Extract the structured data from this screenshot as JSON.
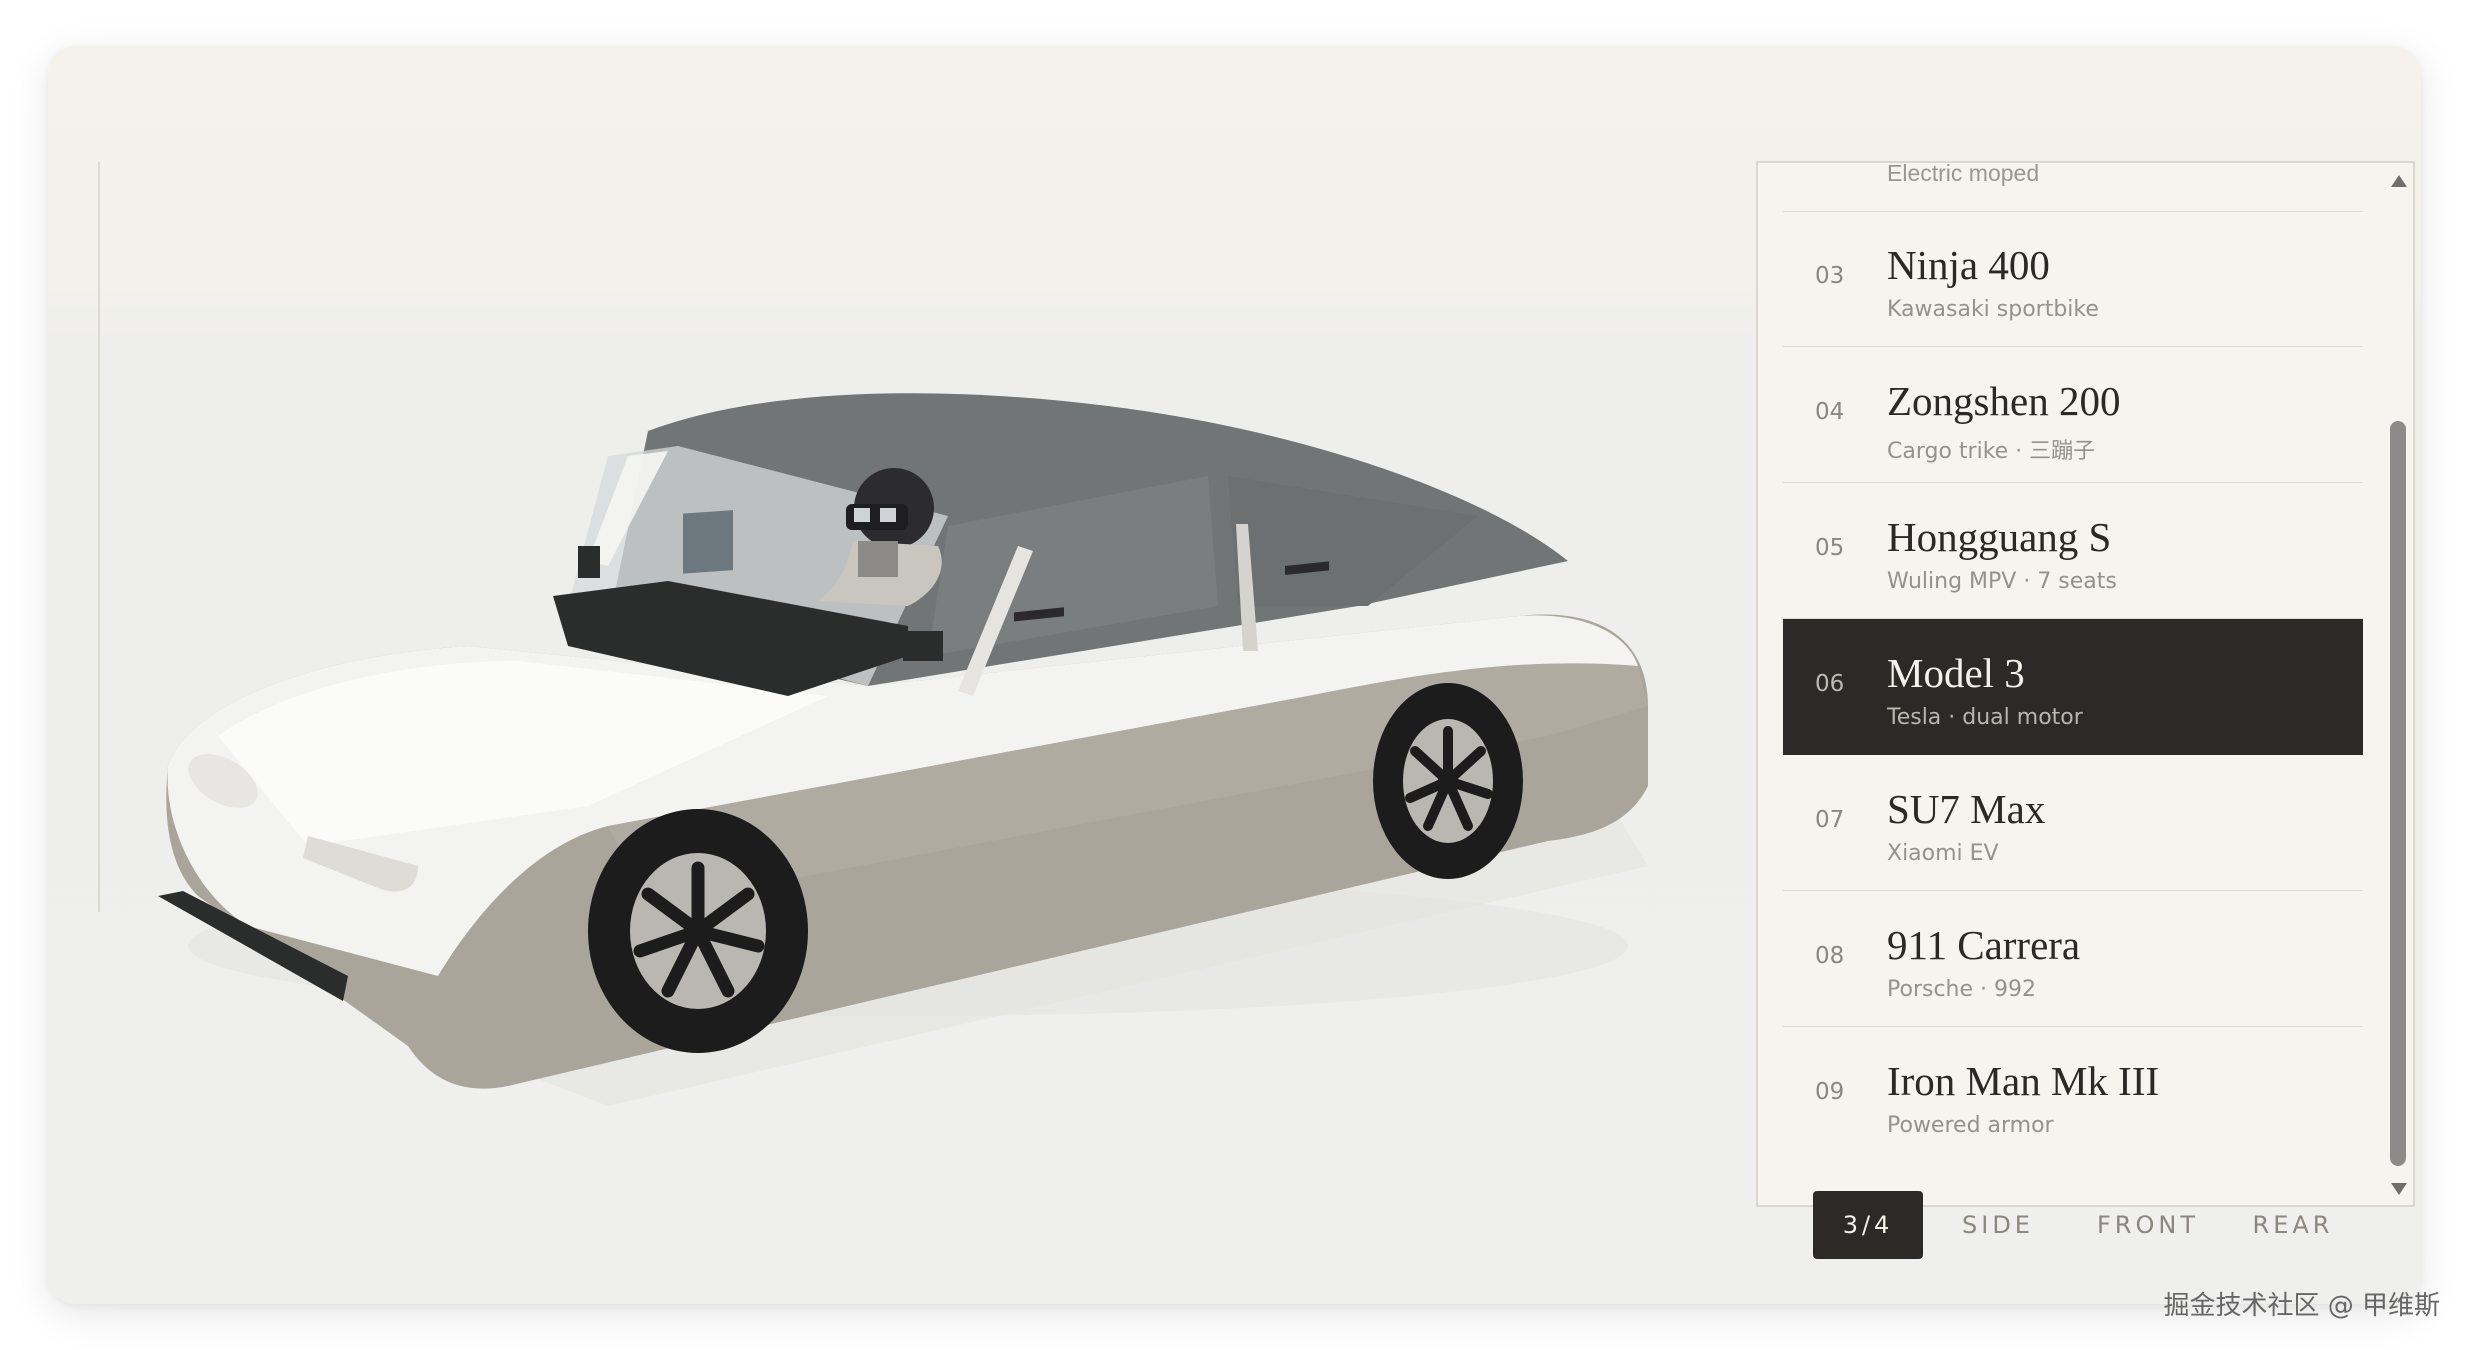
{
  "list": {
    "partial_item_subtitle": "Electric moped",
    "items": [
      {
        "num": "03",
        "title": "Ninja 400",
        "subtitle": "Kawasaki sportbike"
      },
      {
        "num": "04",
        "title": "Zongshen 200",
        "subtitle": "Cargo trike · 三蹦子"
      },
      {
        "num": "05",
        "title": "Hongguang S",
        "subtitle": "Wuling MPV · 7 seats"
      },
      {
        "num": "06",
        "title": "Model 3",
        "subtitle": "Tesla · dual motor"
      },
      {
        "num": "07",
        "title": "SU7 Max",
        "subtitle": "Xiaomi EV"
      },
      {
        "num": "08",
        "title": "911 Carrera",
        "subtitle": "Porsche · 992"
      },
      {
        "num": "09",
        "title": "Iron Man Mk III",
        "subtitle": "Powered armor"
      }
    ],
    "active_index": 3
  },
  "views": {
    "three_quarter": "3/4",
    "side": "SIDE",
    "front": "FRONT",
    "rear": "REAR",
    "active": "3/4"
  },
  "watermark": "掘金技术社区 @ 甲维斯",
  "colors": {
    "accent_dark": "#2b2a27",
    "panel_bg": "#f5f4ee",
    "car_body": "#aca79c",
    "car_roof": "#6f7171"
  },
  "icons": [
    "scroll-up-arrow-icon",
    "scroll-down-arrow-icon"
  ]
}
